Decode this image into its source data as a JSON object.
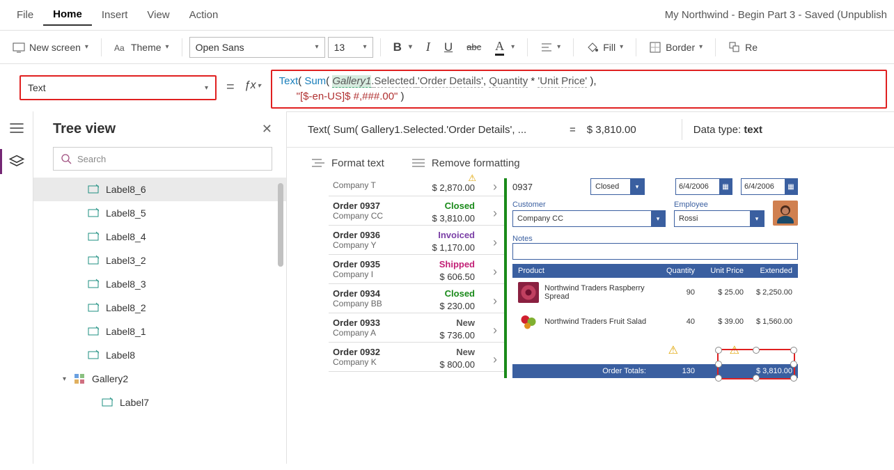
{
  "menu": {
    "file": "File",
    "home": "Home",
    "insert": "Insert",
    "view": "View",
    "action": "Action"
  },
  "title": "My Northwind - Begin Part 3 - Saved (Unpublish",
  "ribbon": {
    "newscreen": "New screen",
    "theme": "Theme",
    "font": "Open Sans",
    "size": "13",
    "fill": "Fill",
    "border": "Border",
    "reorder": "Re"
  },
  "property": "Text",
  "formula": {
    "fn1": "Text",
    "op1": "( ",
    "fn2": "Sum",
    "op2": "( ",
    "id": "Gallery1",
    "dot": ".",
    "sel": "Selected",
    "dot2": ".",
    "od": "'Order Details'",
    "comma": ", ",
    "qty": "Quantity",
    "times": " * ",
    "up": "'Unit Price'",
    "close1": " )",
    "comma2": ",",
    "indent": "      ",
    "str": "\"[$-en-US]$ #,###.00\"",
    "close2": " )"
  },
  "eval": {
    "expr": "Text( Sum( Gallery1.Selected.'Order Details', ...",
    "eq": "=",
    "result": "$ 3,810.00",
    "datatype_lbl": "Data type: ",
    "datatype": "text"
  },
  "fmt": {
    "format": "Format text",
    "remove": "Remove formatting"
  },
  "tree": {
    "title": "Tree view",
    "search": "Search",
    "items": [
      "Label8_6",
      "Label8_5",
      "Label8_4",
      "Label3_2",
      "Label8_3",
      "Label8_2",
      "Label8_1",
      "Label8",
      "Gallery2",
      "Label7"
    ]
  },
  "orders": [
    {
      "hdr": "",
      "co": "Company T",
      "st": "",
      "stc": "",
      "amt": "$ 2,870.00"
    },
    {
      "hdr": "Order 0937",
      "co": "Company CC",
      "st": "Closed",
      "stc": "st-closed",
      "amt": "$ 3,810.00"
    },
    {
      "hdr": "Order 0936",
      "co": "Company Y",
      "st": "Invoiced",
      "stc": "st-invoiced",
      "amt": "$ 1,170.00"
    },
    {
      "hdr": "Order 0935",
      "co": "Company I",
      "st": "Shipped",
      "stc": "st-shipped",
      "amt": "$ 606.50"
    },
    {
      "hdr": "Order 0934",
      "co": "Company BB",
      "st": "Closed",
      "stc": "st-closed",
      "amt": "$ 230.00"
    },
    {
      "hdr": "Order 0933",
      "co": "Company A",
      "st": "New",
      "stc": "st-new",
      "amt": "$ 736.00"
    },
    {
      "hdr": "Order 0932",
      "co": "Company K",
      "st": "New",
      "stc": "st-new",
      "amt": "$ 800.00"
    }
  ],
  "detail": {
    "order": "0937",
    "status": "Closed",
    "date1": "6/4/2006",
    "date2": "6/4/2006",
    "customer_lbl": "Customer",
    "customer": "Company CC",
    "employee_lbl": "Employee",
    "employee": "Rossi",
    "notes_lbl": "Notes",
    "grid": {
      "product": "Product",
      "qty": "Quantity",
      "price": "Unit Price",
      "ext": "Extended"
    },
    "rows": [
      {
        "name": "Northwind Traders Raspberry Spread",
        "qty": "90",
        "price": "$ 25.00",
        "ext": "$ 2,250.00"
      },
      {
        "name": "Northwind Traders Fruit Salad",
        "qty": "40",
        "price": "$ 39.00",
        "ext": "$ 1,560.00"
      }
    ],
    "totals_lbl": "Order Totals:",
    "totals_qty": "130",
    "totals_amt": "$ 3,810.00"
  }
}
